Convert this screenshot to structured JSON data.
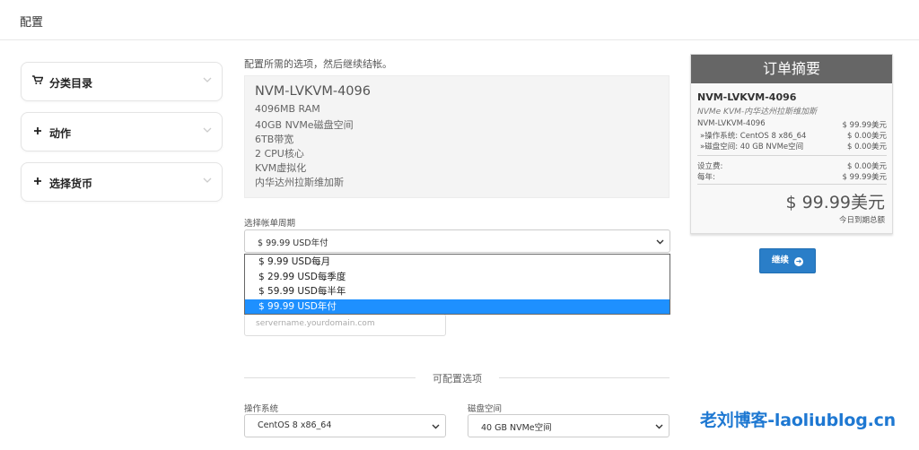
{
  "header": {
    "title": "配置"
  },
  "sidebar": {
    "items": [
      {
        "label": "分类目录",
        "icon": "cart-icon"
      },
      {
        "label": "动作",
        "icon": "plus-icon"
      },
      {
        "label": "选择货币",
        "icon": "plus-icon"
      }
    ]
  },
  "main": {
    "intro": "配置所需的选项，然后继续结帐。",
    "product": {
      "name": "NVM-LVKVM-4096",
      "specs": [
        "4096MB RAM",
        "40GB NVMe磁盘空间",
        "6TB带宽",
        "2 CPU核心",
        "KVM虚拟化",
        "内华达州拉斯维加斯"
      ]
    },
    "billing_cycle": {
      "label": "选择帐单周期",
      "selected": "$ 99.99 USD年付",
      "options": [
        "$ 9.99 USD每月",
        "$ 29.99 USD每季度",
        "$ 59.99 USD每半年",
        "$ 99.99 USD年付"
      ],
      "highlighted_index": 3
    },
    "hostname": {
      "placeholder": "servername.yourdomain.com"
    },
    "configurable_options": {
      "title": "可配置选项",
      "os_label": "操作系统",
      "os_value": "CentOS 8 x86_64",
      "disk_label": "磁盘空间",
      "disk_value": "40 GB NVMe空间"
    }
  },
  "summary": {
    "title": "订单摘要",
    "product_name": "NVM-LVKVM-4096",
    "product_group": "NVMe KVM-内华达州拉斯维加斯",
    "lines": [
      {
        "label": "NVM-LVKVM-4096",
        "value": "$ 99.99美元"
      },
      {
        "label": "»操作系统:  CentOS 8 x86_64",
        "value": "$ 0.00美元"
      },
      {
        "label": "»磁盘空间:  40 GB NVMe空间",
        "value": "$ 0.00美元"
      }
    ],
    "setup_label": "设立费:",
    "setup_value": "$ 0.00美元",
    "annual_label": "每年:",
    "annual_value": "$ 99.99美元",
    "total": "$ 99.99美元",
    "due_today": "今日到期总额",
    "continue_label": "继续"
  },
  "watermark": "老刘博客-laoliublog.cn"
}
